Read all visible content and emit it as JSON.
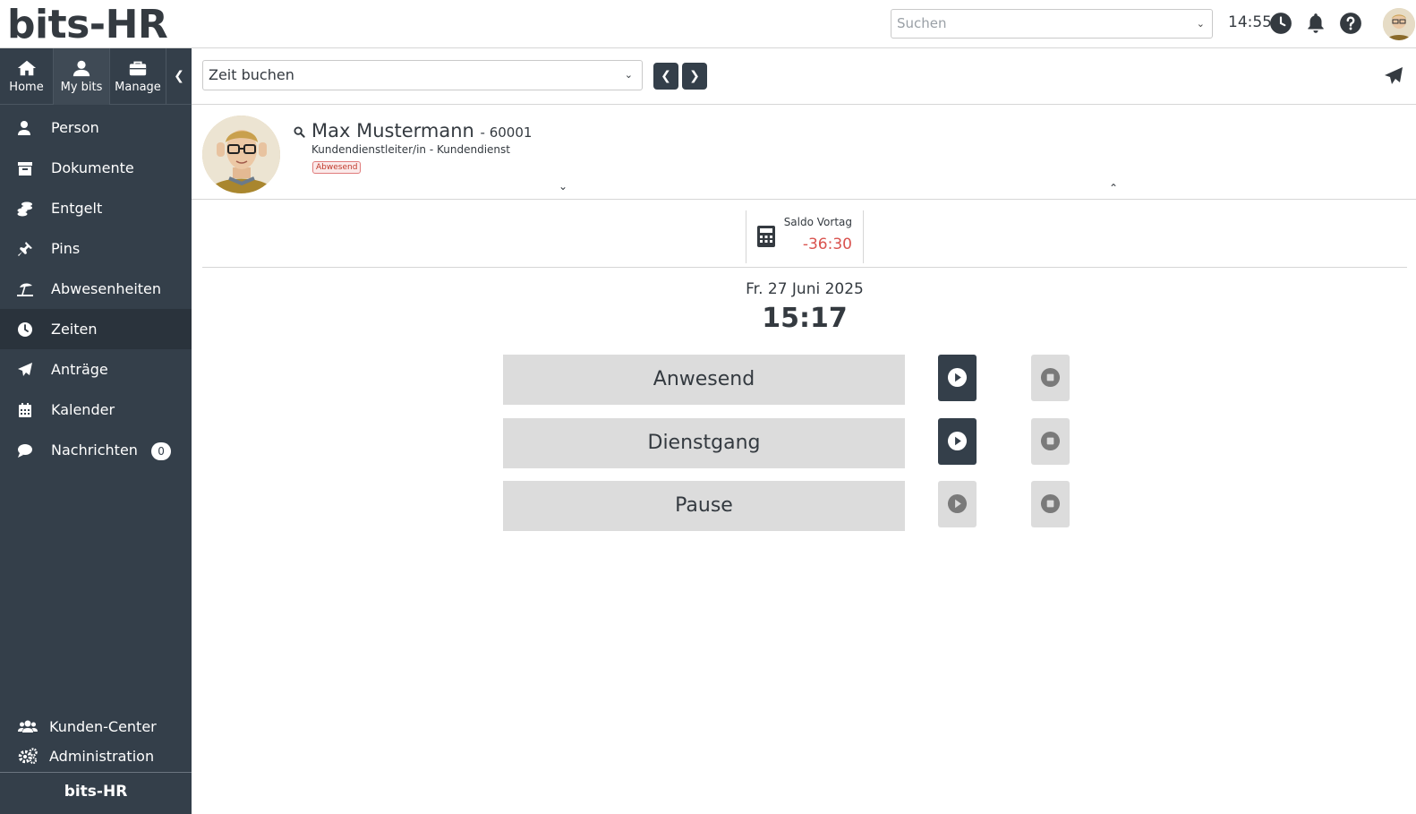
{
  "app": {
    "logo": "bits-HR"
  },
  "header": {
    "search_placeholder": "Suchen",
    "clock": "14:55"
  },
  "sidebar": {
    "tabs": [
      {
        "label": "Home",
        "icon": "home-icon"
      },
      {
        "label": "My bits",
        "icon": "user-icon"
      },
      {
        "label": "Manage",
        "icon": "briefcase-icon"
      }
    ],
    "items": [
      {
        "label": "Person",
        "icon": "user-icon"
      },
      {
        "label": "Dokumente",
        "icon": "archive-icon"
      },
      {
        "label": "Entgelt",
        "icon": "coins-icon"
      },
      {
        "label": "Pins",
        "icon": "thumbtack-icon"
      },
      {
        "label": "Abwesenheiten",
        "icon": "umbrella-beach-icon"
      },
      {
        "label": "Zeiten",
        "icon": "clock-icon",
        "active": true
      },
      {
        "label": "Anträge",
        "icon": "paper-plane-icon"
      },
      {
        "label": "Kalender",
        "icon": "calendar-icon"
      },
      {
        "label": "Nachrichten",
        "icon": "comment-icon",
        "badge": "0"
      }
    ],
    "bottom_items": [
      {
        "label": "Kunden-Center",
        "icon": "users-icon"
      },
      {
        "label": "Administration",
        "icon": "cogs-icon"
      }
    ],
    "footer": "bits-HR"
  },
  "toolbar": {
    "select_value": "Zeit buchen"
  },
  "person": {
    "name": "Max Mustermann",
    "id": "- 60001",
    "role": "Kundendienstleiter/in - Kundendienst",
    "status": "Abwesend"
  },
  "saldo": {
    "label": "Saldo Vortag",
    "value": "-36:30",
    "value_color": "#d9534f"
  },
  "booking": {
    "date": "Fr. 27 Juni 2025",
    "time": "15:17",
    "rows": [
      {
        "label": "Anwesend",
        "start_enabled": true,
        "stop_enabled": false
      },
      {
        "label": "Dienstgang",
        "start_enabled": true,
        "stop_enabled": false
      },
      {
        "label": "Pause",
        "start_enabled": false,
        "stop_enabled": false
      }
    ]
  },
  "colors": {
    "sidebar": "#343f4a",
    "accent_dark": "#343f4a",
    "negative": "#d9534f"
  }
}
